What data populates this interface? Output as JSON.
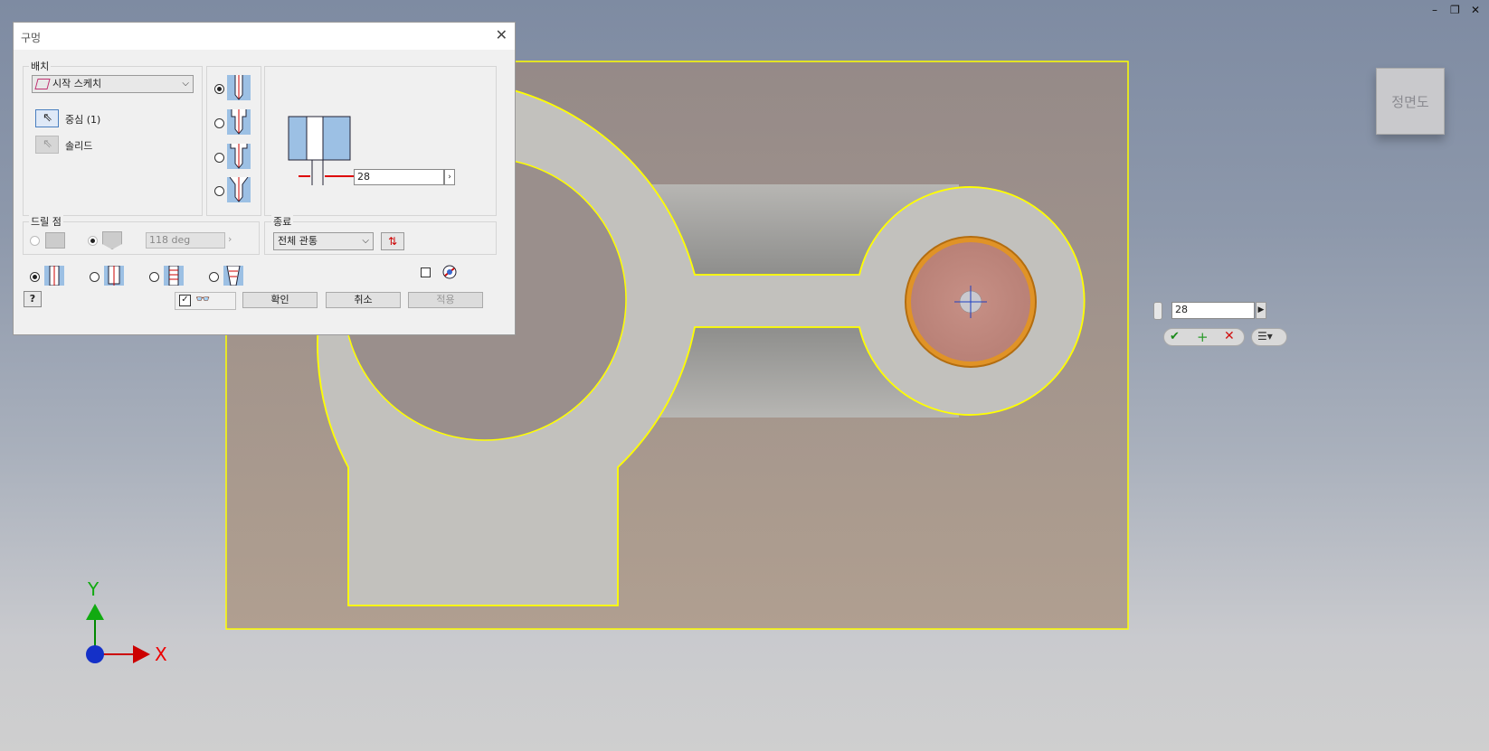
{
  "window_controls": {
    "minimize": "–",
    "restore": "❐",
    "close": "✕"
  },
  "viewcube": {
    "label": "정면도"
  },
  "dialog": {
    "title": "구멍",
    "placement": {
      "label": "배치",
      "dropdown": "시작 스케치",
      "center_label": "중심 (1)",
      "solid_label": "솔리드"
    },
    "diameter_value": "28",
    "drill_point": {
      "label": "드릴 점",
      "angle": "118 deg"
    },
    "termination": {
      "label": "종료",
      "dropdown": "전체 관통"
    },
    "buttons": {
      "ok": "확인",
      "cancel": "취소",
      "apply": "적용"
    }
  },
  "mini_toolbar": {
    "value": "28"
  },
  "axes": {
    "x": "X",
    "y": "Y"
  },
  "colors": {
    "sketch_highlight": "#ffff00",
    "plate": "#a59c98",
    "part_face": "#c3c3c0",
    "hole_preview": "#c28a7a",
    "hole_rim": "#e29520"
  }
}
